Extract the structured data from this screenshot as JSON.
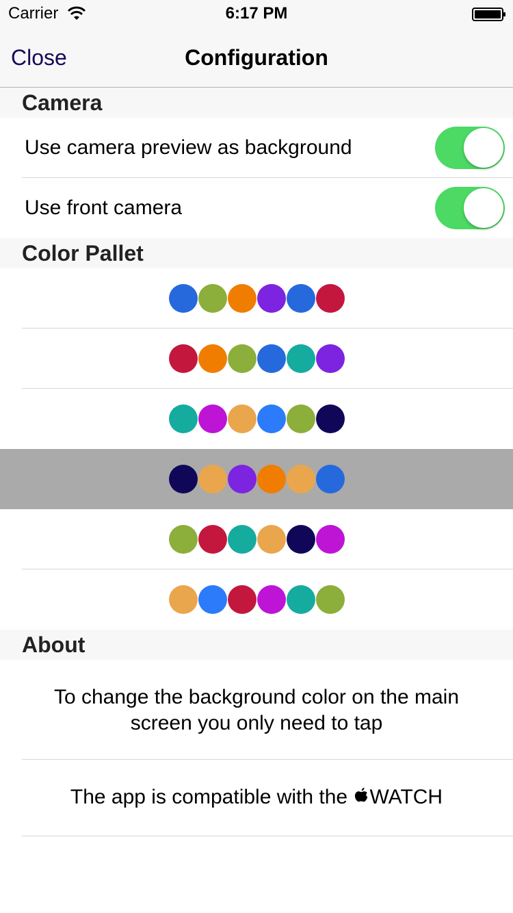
{
  "status_bar": {
    "carrier": "Carrier",
    "time": "6:17 PM"
  },
  "nav": {
    "close_label": "Close",
    "title": "Configuration",
    "tint_color": "#150a57"
  },
  "sections": {
    "camera": "Camera",
    "color_pallet": "Color Pallet",
    "about": "About"
  },
  "camera": {
    "rows": [
      {
        "label": "Use camera preview as background",
        "enabled": true
      },
      {
        "label": "Use front camera",
        "enabled": true
      }
    ],
    "switch_on_color": "#4cd964"
  },
  "palettes": {
    "selected_index": 3,
    "rows": [
      {
        "colors": [
          "#2669dd",
          "#8cae3b",
          "#f07d00",
          "#7d24e0",
          "#2669dd",
          "#c3173e"
        ]
      },
      {
        "colors": [
          "#c3173e",
          "#f07d00",
          "#8cae3b",
          "#2669dd",
          "#16ab9f",
          "#7d24e0"
        ]
      },
      {
        "colors": [
          "#16ab9f",
          "#bd14d6",
          "#eaa64c",
          "#2b7bfa",
          "#8cae3b",
          "#110759"
        ]
      },
      {
        "colors": [
          "#110759",
          "#eaa64c",
          "#7d24e0",
          "#f07d00",
          "#eaa64c",
          "#2669dd"
        ]
      },
      {
        "colors": [
          "#8cae3b",
          "#c3173e",
          "#16ab9f",
          "#eaa64c",
          "#110759",
          "#bd14d6"
        ]
      },
      {
        "colors": [
          "#eaa64c",
          "#2b7bfa",
          "#c3173e",
          "#bd14d6",
          "#16ab9f",
          "#8cae3b"
        ]
      }
    ]
  },
  "about": {
    "line1": "To change the background color on the main",
    "line2": "screen you only need to tap",
    "watch_prefix": "The app is compatible with the ",
    "watch_suffix": "WATCH"
  }
}
